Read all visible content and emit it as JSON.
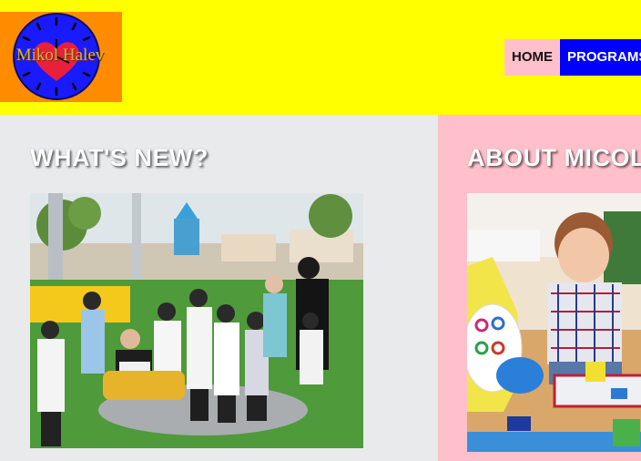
{
  "header": {
    "logo_text": "Mikol Halev",
    "nav": [
      {
        "label": "HOME"
      },
      {
        "label": "PROGRAMS"
      }
    ]
  },
  "whats_new": {
    "title": "WHAT'S NEW?"
  },
  "about": {
    "title": "ABOUT MICOL HALEV"
  },
  "colors": {
    "header_bg": "#ffff00",
    "logo_bg": "#ff8c00",
    "nav_home_bg": "#ffc0cb",
    "nav_programs_bg": "#0000ff",
    "left_column_bg": "#e8eaec",
    "right_column_bg": "#ffc0cb"
  }
}
